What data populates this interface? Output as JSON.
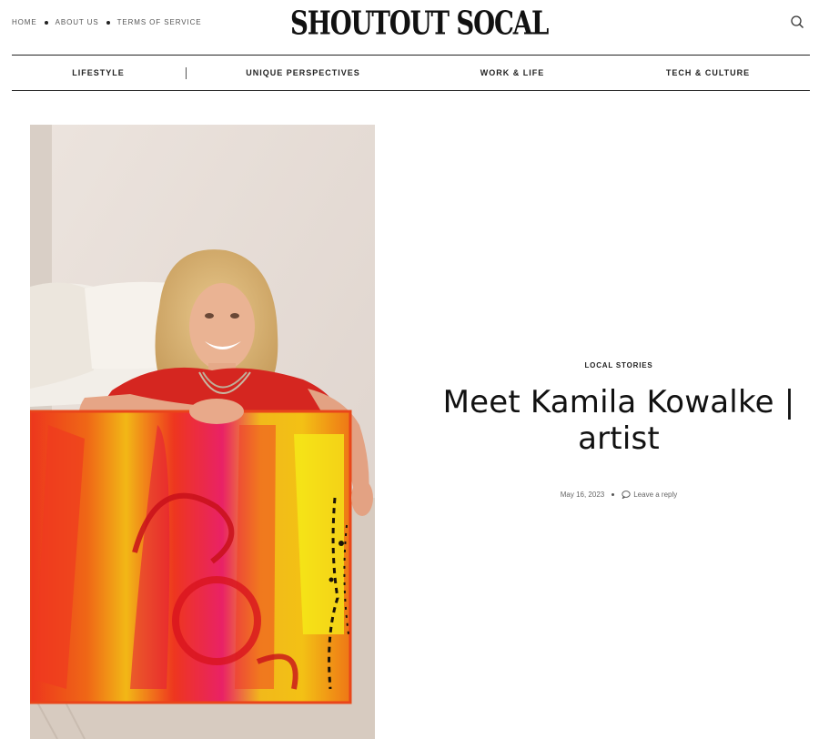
{
  "header": {
    "top_links": [
      "HOME",
      "ABOUT US",
      "TERMS OF SERVICE"
    ],
    "logo": "SHOUTOUT SOCAL",
    "search_icon": "search-icon"
  },
  "nav": {
    "items": [
      "LIFESTYLE",
      "UNIQUE PERSPECTIVES",
      "WORK & LIFE",
      "TECH & CULTURE"
    ]
  },
  "article": {
    "category": "LOCAL STORIES",
    "title": "Meet Kamila Kowalke | artist",
    "date": "May 16, 2023",
    "reply_label": "Leave a reply",
    "reply_icon": "comment-icon"
  },
  "colors": {
    "painting_red": "#ea2418",
    "painting_yellow": "#f4f10c",
    "painting_pink": "#e8498a",
    "shirt_red": "#d8281e",
    "wall": "#e9dfd8"
  }
}
